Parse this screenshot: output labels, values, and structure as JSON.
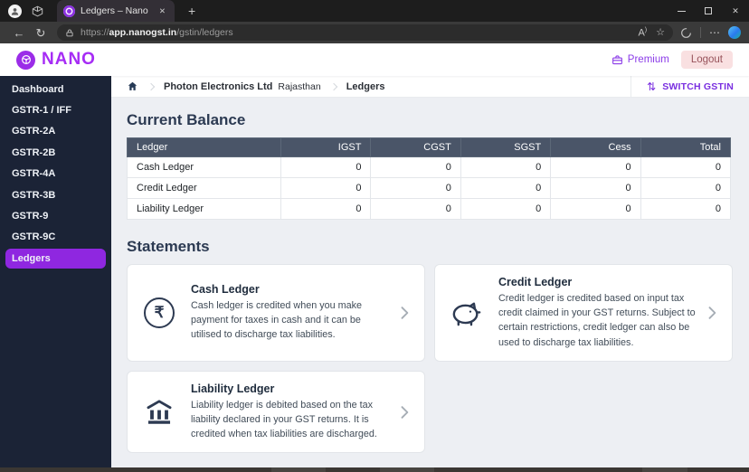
{
  "browser": {
    "tab_title": "Ledgers – Nano",
    "url_protocol": "https://",
    "url_domain": "app.nanogst.in",
    "url_path": "/gstin/ledgers"
  },
  "icons": {
    "back": "←",
    "reload": "↻",
    "read_aloud": "A",
    "star": "☆",
    "overflow_dots": "⋯",
    "new_tab": "+",
    "tab_close": "✕",
    "window_close": "✕",
    "switch_arrows": "⇅",
    "rupee": "₹"
  },
  "header": {
    "logo_text": "NANO",
    "premium_label": "Premium",
    "logout_label": "Logout"
  },
  "breadcrumb": {
    "company": "Photon Electronics Ltd",
    "state": "Rajasthan",
    "current": "Ledgers",
    "switch_gstin_label": "SWITCH GSTIN"
  },
  "sidebar": {
    "items": [
      {
        "label": "Dashboard",
        "active": false
      },
      {
        "label": "GSTR-1 / IFF",
        "active": false
      },
      {
        "label": "GSTR-2A",
        "active": false
      },
      {
        "label": "GSTR-2B",
        "active": false
      },
      {
        "label": "GSTR-4A",
        "active": false
      },
      {
        "label": "GSTR-3B",
        "active": false
      },
      {
        "label": "GSTR-9",
        "active": false
      },
      {
        "label": "GSTR-9C",
        "active": false
      },
      {
        "label": "Ledgers",
        "active": true
      }
    ]
  },
  "current_balance": {
    "title": "Current Balance",
    "columns": [
      "Ledger",
      "IGST",
      "CGST",
      "SGST",
      "Cess",
      "Total"
    ],
    "rows": [
      [
        "Cash Ledger",
        "0",
        "0",
        "0",
        "0",
        "0"
      ],
      [
        "Credit Ledger",
        "0",
        "0",
        "0",
        "0",
        "0"
      ],
      [
        "Liability Ledger",
        "0",
        "0",
        "0",
        "0",
        "0"
      ]
    ]
  },
  "statements": {
    "title": "Statements",
    "cards": [
      {
        "icon": "rupee-circle-icon",
        "title": "Cash Ledger",
        "description": "Cash ledger is credited when you make payment for taxes in cash and it can be utilised to discharge tax liabilities."
      },
      {
        "icon": "piggy-bank-icon",
        "title": "Credit Ledger",
        "description": "Credit ledger is credited based on input tax credit claimed in your GST returns. Subject to certain restrictions, credit ledger can also be used to discharge tax liabilities."
      },
      {
        "icon": "bank-building-icon",
        "title": "Liability Ledger",
        "description": "Liability ledger is debited based on the tax liability declared in your GST returns. It is credited when tax liabilities are discharged."
      }
    ]
  },
  "colors": {
    "accent_purple": "#8f27e0",
    "logo_purple": "#a62cf5",
    "sidebar_bg": "#1b2336",
    "table_header_bg": "#4a5568",
    "heading_navy": "#2c3a52",
    "content_bg": "#edeff3",
    "logout_bg": "#f9e0e1",
    "logout_text": "#97525a"
  }
}
